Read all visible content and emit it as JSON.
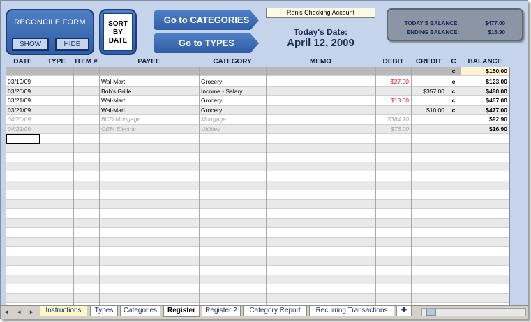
{
  "panel": {
    "reconcile_title": "RECONCILE FORM",
    "show_label": "SHOW",
    "hide_label": "HIDE",
    "sort_label_1": "SORT",
    "sort_label_2": "BY",
    "sort_label_3": "DATE",
    "go_categories": "Go to CATEGORIES",
    "go_types": "Go to TYPES",
    "account_name": "Ron's Checking Account",
    "todays_date_label": "Today's Date:",
    "todays_date_value": "April 12, 2009",
    "todays_balance_label": "TODAY'S BALANCE:",
    "todays_balance_value": "$477.00",
    "ending_balance_label": "ENDING BALANCE:",
    "ending_balance_value": "$16.90"
  },
  "headers": {
    "date": "DATE",
    "type": "TYPE",
    "item": "ITEM #",
    "payee": "PAYEE",
    "category": "CATEGORY",
    "memo": "MEMO",
    "debit": "DEBIT",
    "credit": "CREDIT",
    "c": "C",
    "balance": "BALANCE"
  },
  "opening": {
    "c": "c",
    "balance": "$150.00"
  },
  "rows": [
    {
      "date": "03/19/09",
      "payee": "Wal-Mart",
      "category": "Grocery",
      "debit": "$27.00",
      "credit": "",
      "c": "c",
      "balance": "$123.00"
    },
    {
      "date": "03/20/09",
      "payee": "Bob's Grille",
      "category": "Income - Salary",
      "debit": "",
      "credit": "$357.00",
      "c": "c",
      "balance": "$480.00"
    },
    {
      "date": "03/21/09",
      "payee": "Wal-Mart",
      "category": "Grocery",
      "debit": "$13.00",
      "credit": "",
      "c": "c",
      "balance": "$467.00"
    },
    {
      "date": "03/21/09",
      "payee": "Wal-Mart",
      "category": "Grocery",
      "debit": "",
      "credit": "$10.00",
      "c": "c",
      "balance": "$477.00"
    },
    {
      "date": "04/20/09",
      "payee": "BCD Mortgage",
      "category": "Mortgage",
      "debit": "$384.10",
      "credit": "",
      "c": "",
      "balance": "$92.90"
    },
    {
      "date": "04/21/09",
      "payee": "OEM Electric",
      "category": "Utilities",
      "debit": "$76.00",
      "credit": "",
      "c": "",
      "balance": "$16.90"
    }
  ],
  "tabs": {
    "nav": "◄ ◄ ► ►",
    "instructions": "Instructions",
    "types": "Types",
    "categories": "Categories",
    "register": "Register",
    "register2": "Register 2",
    "category_report": "Category Report",
    "recurring": "Recurring Transactions"
  },
  "colors": {
    "frame_bg": "#c5d4ea",
    "button_blue": "#3b6cb5",
    "debit_red": "#e01c1c",
    "future_gray": "#a3a3a3",
    "balance_col": "#fdf3d2"
  }
}
